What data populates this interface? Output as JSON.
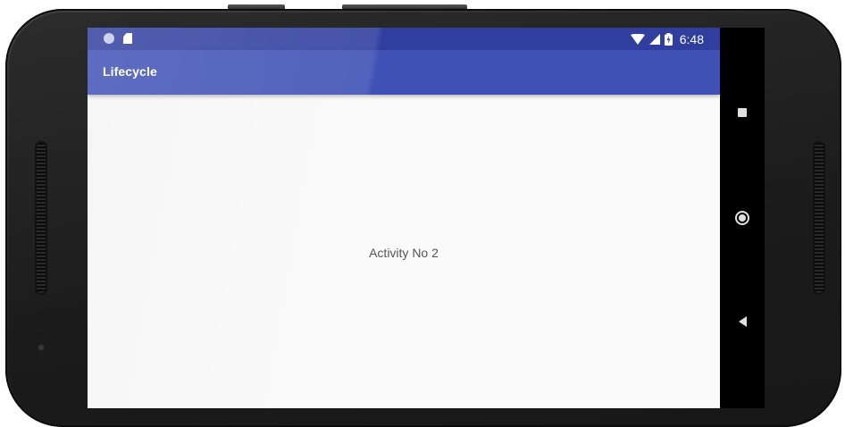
{
  "app": {
    "title": "Lifecycle",
    "content_text": "Activity No 2"
  },
  "statusbar": {
    "time": "6:48",
    "icons_left": [
      "notification-dot-icon",
      "sd-card-icon"
    ],
    "icons_right": [
      "wifi-icon",
      "cell-signal-icon",
      "battery-charging-icon"
    ]
  },
  "navbar": {
    "buttons": [
      "recent-apps",
      "home",
      "back"
    ]
  },
  "colors": {
    "primary": "#3f51b5",
    "primary_dark": "#303f9f",
    "background": "#fafafa",
    "text": "#555555"
  }
}
